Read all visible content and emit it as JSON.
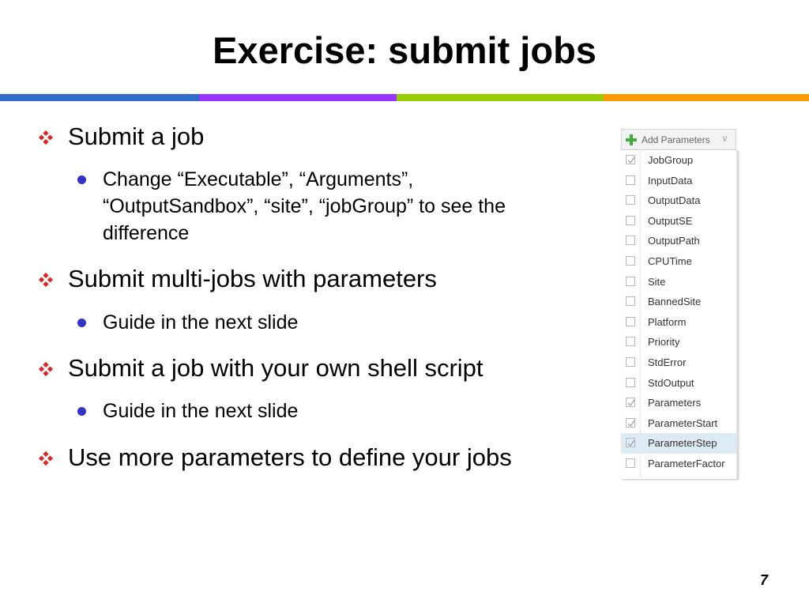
{
  "slide": {
    "title": "Exercise: submit jobs",
    "page_number": "7",
    "accent_colors": [
      "#2f6ccc",
      "#9933ff",
      "#99cc00",
      "#ff9900"
    ],
    "bullet_colors": {
      "level1": "#e02020",
      "level2": "#3333cc"
    }
  },
  "bullets": [
    {
      "text": "Submit a job",
      "sub": [
        "Change “Executable”,  “Arguments”,",
        "“OutputSandbox”, “site”, “jobGroup” to see the",
        "difference"
      ]
    },
    {
      "text": "Submit multi-jobs with parameters",
      "sub": [
        "Guide in the next slide"
      ]
    },
    {
      "text": "Submit a job with your own shell script",
      "sub": [
        "Guide in the next slide"
      ]
    },
    {
      "text": "Use more parameters to define your jobs"
    }
  ],
  "parameters_panel": {
    "button_label": "Add Parameters",
    "icons": {
      "button": "plus-icon",
      "dropdown": "chevron-down-icon"
    },
    "items": [
      {
        "label": "JobGroup",
        "checked": true,
        "highlighted": false
      },
      {
        "label": "InputData",
        "checked": false,
        "highlighted": false
      },
      {
        "label": "OutputData",
        "checked": false,
        "highlighted": false
      },
      {
        "label": "OutputSE",
        "checked": false,
        "highlighted": false
      },
      {
        "label": "OutputPath",
        "checked": false,
        "highlighted": false
      },
      {
        "label": "CPUTime",
        "checked": false,
        "highlighted": false
      },
      {
        "label": "Site",
        "checked": false,
        "highlighted": false
      },
      {
        "label": "BannedSite",
        "checked": false,
        "highlighted": false
      },
      {
        "label": "Platform",
        "checked": false,
        "highlighted": false
      },
      {
        "label": "Priority",
        "checked": false,
        "highlighted": false
      },
      {
        "label": "StdError",
        "checked": false,
        "highlighted": false
      },
      {
        "label": "StdOutput",
        "checked": false,
        "highlighted": false
      },
      {
        "label": "Parameters",
        "checked": true,
        "highlighted": false
      },
      {
        "label": "ParameterStart",
        "checked": true,
        "highlighted": false
      },
      {
        "label": "ParameterStep",
        "checked": true,
        "highlighted": true
      },
      {
        "label": "ParameterFactor",
        "checked": false,
        "highlighted": false
      }
    ]
  }
}
